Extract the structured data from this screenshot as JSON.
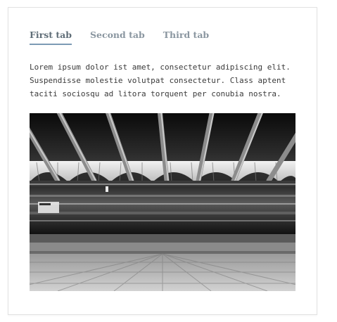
{
  "tabs": [
    {
      "label": "First tab",
      "active": true
    },
    {
      "label": "Second tab",
      "active": false
    },
    {
      "label": "Third tab",
      "active": false
    }
  ],
  "content": {
    "paragraph": "Lorem ipsum dolor ist amet, consectetur adipiscing elit. Suspendisse molestie volutpat consectetur. Class aptent taciti sociosqu ad litora torquent per conubia nostra."
  },
  "colors": {
    "active_tab_text": "#5f6d77",
    "inactive_tab_text": "#8a96a0",
    "tab_underline": "#7c9bb5",
    "body_text": "#3a3a3a",
    "card_border": "#e1e1e1"
  }
}
